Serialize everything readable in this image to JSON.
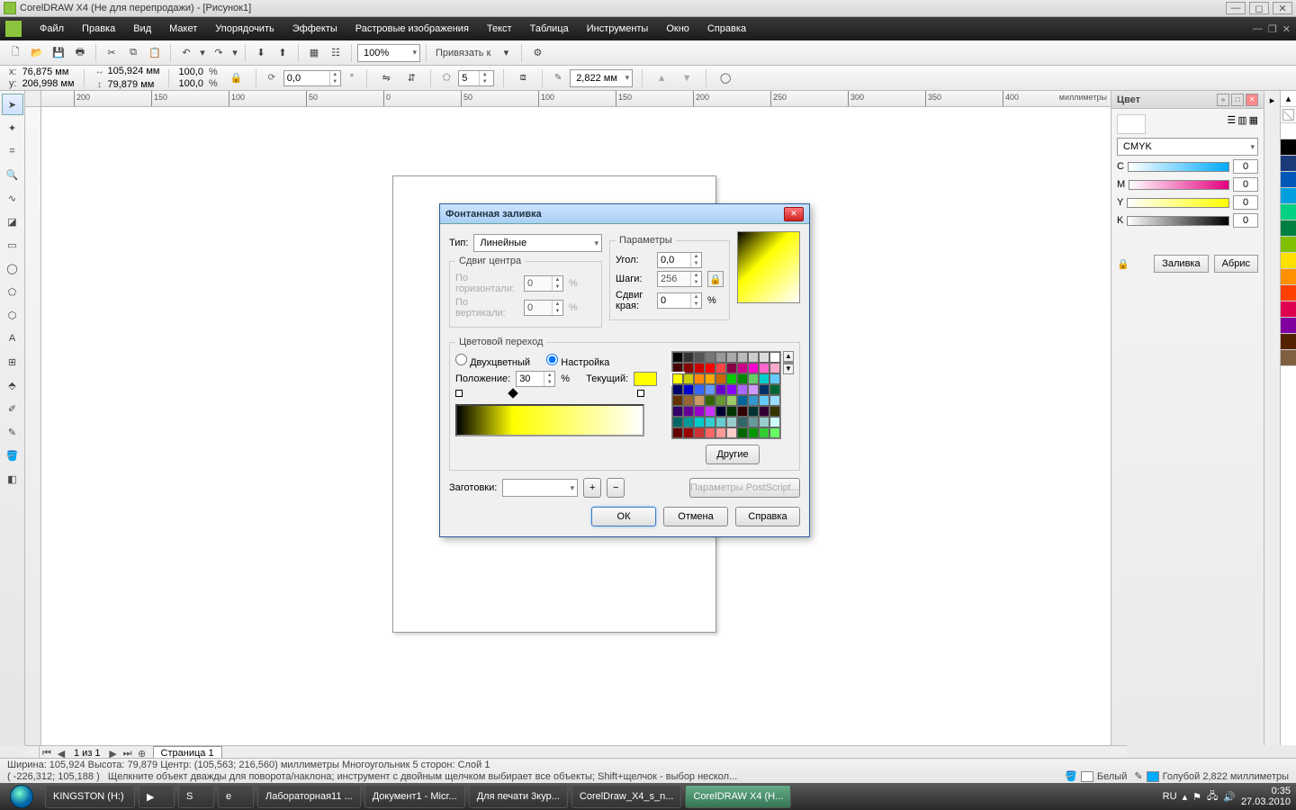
{
  "title": "CorelDRAW X4 (Не для перепродажи) - [Рисунок1]",
  "menu": [
    "Файл",
    "Правка",
    "Вид",
    "Макет",
    "Упорядочить",
    "Эффекты",
    "Растровые изображения",
    "Текст",
    "Таблица",
    "Инструменты",
    "Окно",
    "Справка"
  ],
  "toolbar1": {
    "zoom": "100%",
    "snap_label": "Привязать к"
  },
  "toolbar2": {
    "x": "76,875 мм",
    "y": "206,998 мм",
    "w": "105,924 мм",
    "h": "79,879 мм",
    "sx": "100,0",
    "sy": "100,0",
    "rot": "0,0",
    "spokes": "5",
    "outline": "2,822 мм"
  },
  "ruler_ticks": [
    "200",
    "150",
    "100",
    "50",
    "0",
    "50",
    "100",
    "150",
    "200",
    "250",
    "300",
    "350",
    "400"
  ],
  "ruler_units": "миллиметры",
  "panel": {
    "title": "Цвет",
    "mode": "CMYK",
    "c": "0",
    "m": "0",
    "y": "0",
    "k": "0",
    "fill_btn": "Заливка",
    "outline_btn": "Абрис"
  },
  "color_strip": [
    "#ffffff",
    "#000000",
    "#1a3a7a",
    "#0057b8",
    "#00a0e0",
    "#00d080",
    "#008040",
    "#80c000",
    "#ffe000",
    "#ff9000",
    "#ff4000",
    "#e00050",
    "#8000a0",
    "#552200",
    "#806040"
  ],
  "pagebar": {
    "page_of": "1 из 1",
    "tab": "Страница 1"
  },
  "status": {
    "line1": "Ширина: 105,924  Высота: 79,879  Центр: (105,563; 216,560)  миллиметры       Многоугольник  5 сторон: Слой 1",
    "coords": "( -226,312; 105,188 )",
    "hint": "Щелкните объект дважды для поворота/наклона; инструмент с двойным щелчком выбирает все объекты; Shift+щелчок - выбор нескол...",
    "fill_name": "Белый",
    "outline_name": "Голубой  2,822 миллиметры"
  },
  "taskbar": {
    "items": [
      "KINGSTON (H:)",
      "",
      "",
      "",
      "Лабораторная11 ...",
      "Документ1 - Micr...",
      "Для печати 3кур...",
      "CorelDraw_X4_s_n...",
      "CorelDRAW X4 (Н..."
    ],
    "lang": "RU",
    "time": "0:35",
    "date": "27.03.2010"
  },
  "dialog": {
    "title": "Фонтанная заливка",
    "type_lbl": "Тип:",
    "type_val": "Линейные",
    "shift_legend": "Сдвиг центра",
    "horiz": "По горизонтали:",
    "vert": "По вертикали:",
    "hval": "0",
    "vval": "0",
    "pct": "%",
    "params_legend": "Параметры",
    "angle_lbl": "Угол:",
    "angle": "0,0",
    "steps_lbl": "Шаги:",
    "steps": "256",
    "edge_lbl": "Сдвиг края:",
    "edge": "0",
    "blend_legend": "Цветовой переход",
    "two": "Двухцветный",
    "custom": "Настройка",
    "pos_lbl": "Положение:",
    "pos": "30",
    "cur_lbl": "Текущий:",
    "other": "Другие",
    "presets_lbl": "Заготовки:",
    "postscript": "Параметры PostScript...",
    "ok": "ОК",
    "cancel": "Отмена",
    "help": "Справка"
  }
}
